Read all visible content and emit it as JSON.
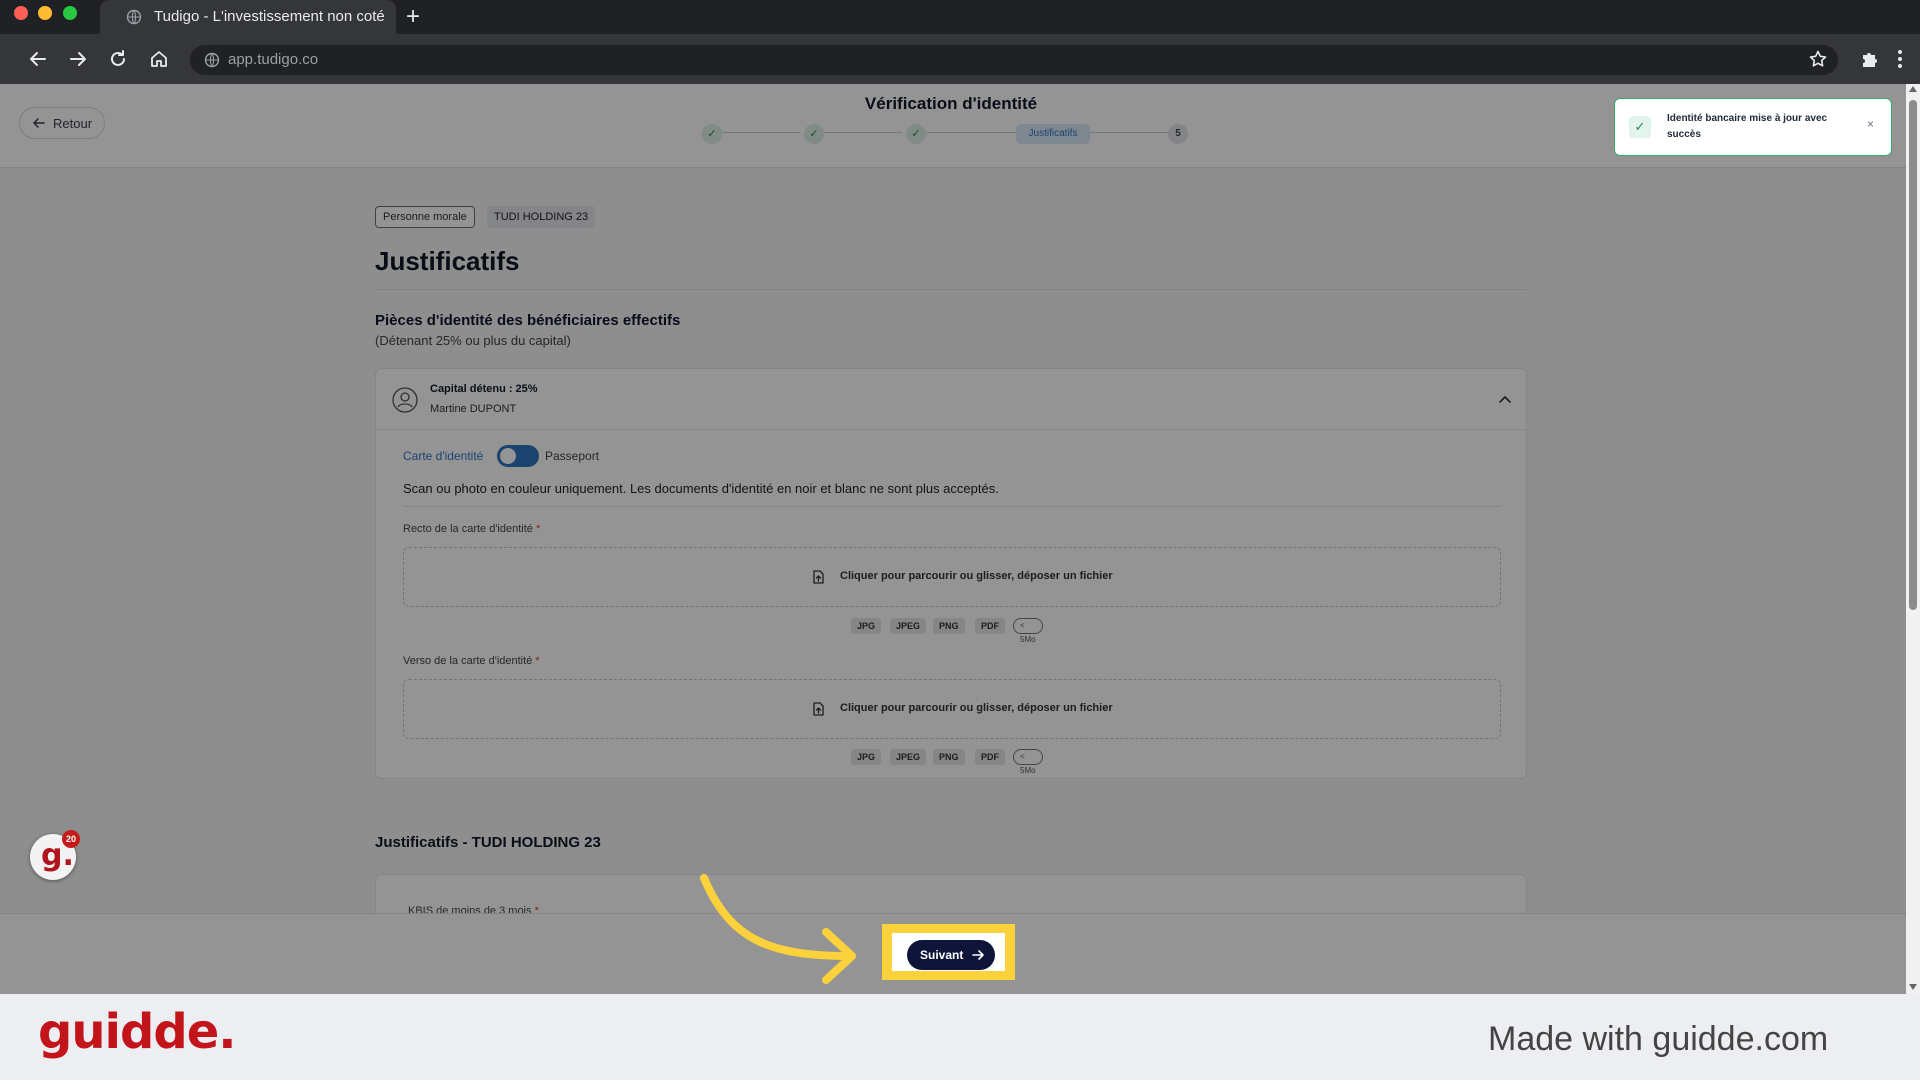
{
  "browser": {
    "tab_title": "Tudigo - L'investissement non coté",
    "new_tab_symbol": "+",
    "url": "app.tudigo.co"
  },
  "header": {
    "back_label": "Retour",
    "title": "Vérification d'identité",
    "steps": [
      {
        "state": "done",
        "label": "✓"
      },
      {
        "state": "done",
        "label": "✓"
      },
      {
        "state": "done",
        "label": "✓"
      },
      {
        "state": "active",
        "label": "Justificatifs"
      },
      {
        "state": "pending",
        "label": "5"
      }
    ]
  },
  "toast": {
    "message": "Identité bancaire mise à jour avec succès",
    "check_symbol": "✓",
    "close_symbol": "×"
  },
  "main": {
    "tags": [
      "Personne morale",
      "TUDI HOLDING 23"
    ],
    "title": "Justificatifs",
    "beneficiaries_title": "Pièces d'identité des bénéficiaires effectifs",
    "beneficiaries_note": "(Détenant 25% ou plus du capital)",
    "beneficiary": {
      "capital": "Capital détenu : 25%",
      "name": "Martine DUPONT"
    },
    "doc_type": {
      "option_left": "Carte d'identité",
      "option_right": "Passeport"
    },
    "notice": "Scan ou photo en couleur uniquement. Les documents d'identité en noir et blanc ne sont plus acceptés.",
    "uploads": [
      {
        "label": "Recto de la carte d'identité",
        "required_mark": "*",
        "dropzone_text": "Cliquer pour parcourir ou glisser, déposer un fichier",
        "formats": [
          "JPG",
          "JPEG",
          "PNG",
          "PDF"
        ],
        "max_size": "< 5Mo"
      },
      {
        "label": "Verso de la carte d'identité",
        "required_mark": "*",
        "dropzone_text": "Cliquer pour parcourir ou glisser, déposer un fichier",
        "formats": [
          "JPG",
          "JPEG",
          "PNG",
          "PDF"
        ],
        "max_size": "< 5Mo"
      }
    ],
    "company_section_title": "Justificatifs - TUDI HOLDING 23",
    "kbis_label": "KBIS de moins de 3 mois",
    "kbis_required_mark": "*"
  },
  "footer": {
    "next_label": "Suivant",
    "avatar_letter": "g.",
    "avatar_count": "20"
  },
  "watermark": {
    "logo": "guidde.",
    "made_with": "Made with guidde.com"
  },
  "colors": {
    "accent_blue": "#2e74c2",
    "success_green": "#1e8a5c",
    "primary_navy": "#0e1538",
    "highlight_yellow": "#fbd23b",
    "guidde_red": "#c3141b"
  }
}
